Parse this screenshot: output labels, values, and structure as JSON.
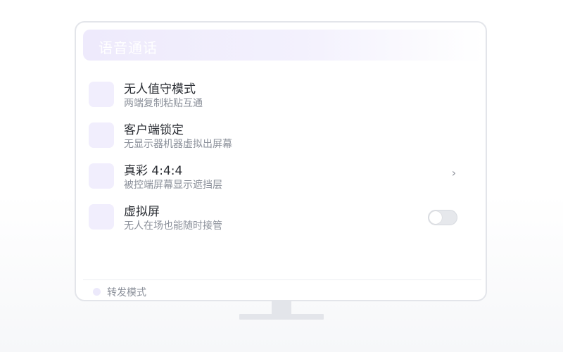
{
  "banner": {
    "title": "语音通话"
  },
  "settings": [
    {
      "title": "无人值守模式",
      "subtitle": "两端复制粘贴互通",
      "control": "none"
    },
    {
      "title": "客户端锁定",
      "subtitle": "无显示器机器虚拟出屏幕",
      "control": "none"
    },
    {
      "title": "真彩 4:4:4",
      "subtitle": "被控端屏幕显示遮挡层",
      "control": "chevron"
    },
    {
      "title": "虚拟屏",
      "subtitle": "无人在场也能随时接管",
      "control": "toggle",
      "toggle_on": false
    }
  ],
  "footer": {
    "label": "转发模式"
  },
  "colors": {
    "accent_soft": "#f1eefd",
    "frame": "#e3e5ea",
    "text_primary": "#2a2d33",
    "text_secondary": "#8a8f99"
  },
  "icons": {
    "chevron": "chevron-right-icon",
    "toggle": "toggle-switch"
  }
}
